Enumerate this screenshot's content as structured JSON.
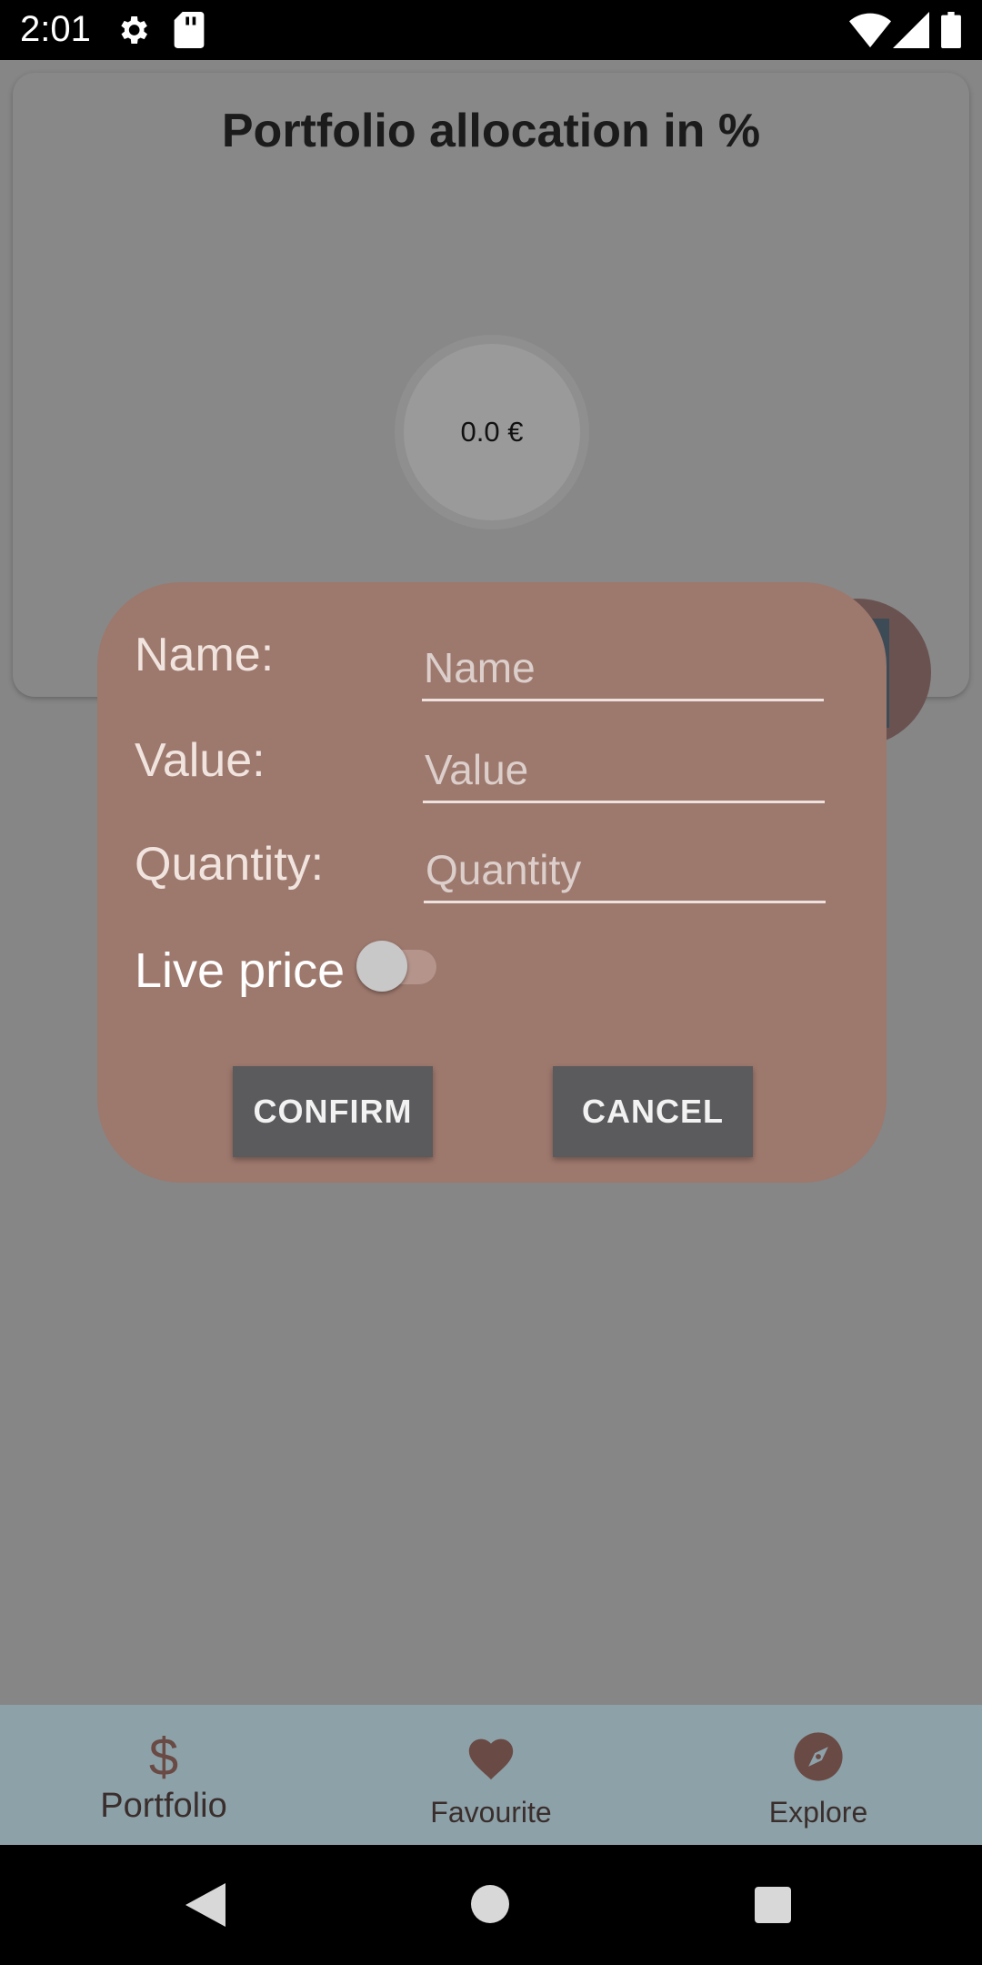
{
  "status_bar": {
    "time": "2:01",
    "icons": [
      "gear-icon",
      "sd-card-icon",
      "wifi-icon",
      "signal-icon",
      "battery-icon"
    ]
  },
  "card": {
    "title": "Portfolio allocation in %",
    "total": "0.0 €"
  },
  "dialog": {
    "name_label": "Name:",
    "name_placeholder": "Name",
    "value_label": "Value:",
    "value_placeholder": "Value",
    "quantity_label": "Quantity:",
    "quantity_placeholder": "Quantity",
    "live_price_label": "Live price",
    "live_price_on": false,
    "confirm_label": "CONFIRM",
    "cancel_label": "CANCEL"
  },
  "bottom_nav": {
    "items": [
      {
        "label": "Portfolio",
        "icon": "dollar-icon",
        "active": true
      },
      {
        "label": "Favourite",
        "icon": "heart-icon",
        "active": false
      },
      {
        "label": "Explore",
        "icon": "compass-icon",
        "active": false
      }
    ]
  },
  "colors": {
    "dialog_bg": "#9d786d",
    "button_bg": "#5b5a5c",
    "nav_bg": "#8da1a9",
    "nav_icon": "#6a4a44"
  }
}
